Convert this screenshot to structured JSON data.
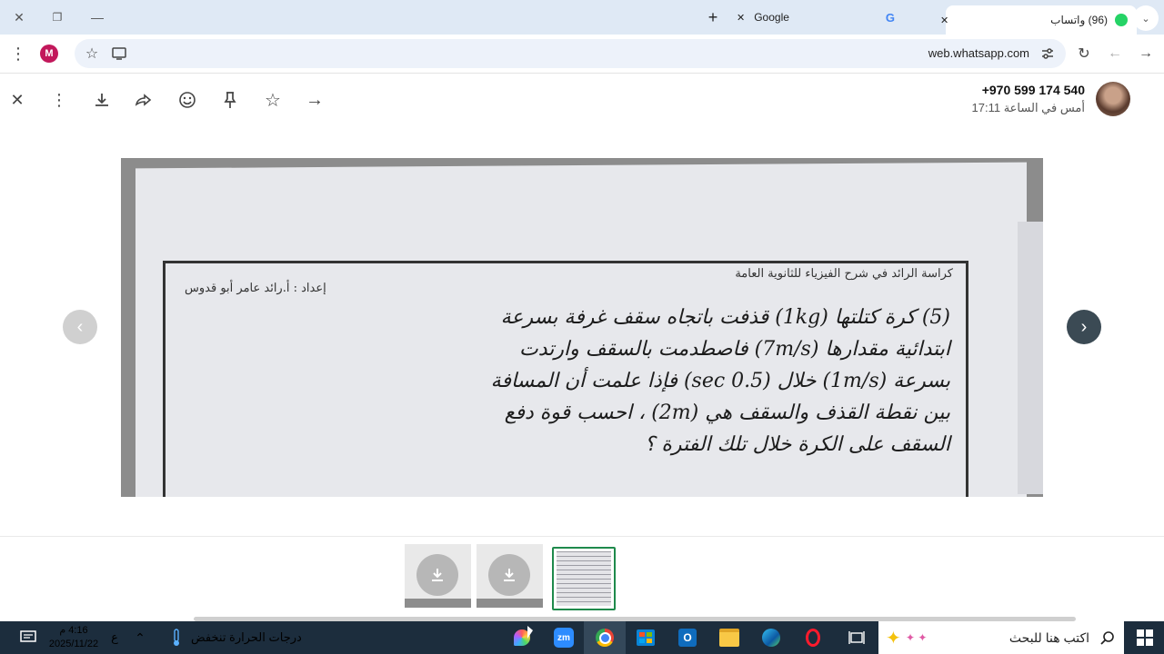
{
  "browser": {
    "tabs": [
      {
        "label": "(96) واتساب",
        "active": true
      },
      {
        "label": "Google",
        "active": false
      }
    ],
    "url": "web.whatsapp.com",
    "profile_initial": "M",
    "new_tab_label": "+",
    "tab_close": "✕"
  },
  "viewer": {
    "sender": "+970 599 174 540",
    "timestamp": "أمس في الساعة 17:11"
  },
  "document": {
    "header_right": "كراسة الرائد في شرح الفيزياء للثانوية العامة",
    "header_left": "إعداد : أ.رائد عامر أبو قدوس",
    "question_lines": [
      "(5) كرة كتلتها (1kg) قذفت باتجاه سقف غرفة بسرعة",
      "ابتدائية مقدارها (7m/s) فاصطدمت بالسقف وارتدت",
      "بسرعة (1m/s) خلال (0.5 sec) فإذا علمت أن المسافة",
      "بين نقطة القذف والسقف هي (2m) ، احسب قوة دفع",
      "السقف على الكرة خلال تلك الفترة ؟"
    ]
  },
  "taskbar": {
    "search_placeholder": "اكتب هنا للبحث",
    "weather_text": "درجات الحرارة تنخفض",
    "time": "4:16 م",
    "date": "2025/11/22",
    "lang": "ع",
    "zoom_label": "zm"
  },
  "colors": {
    "tabbar_bg": "#dfe9f5",
    "taskbar_bg": "#1c2d3d",
    "avatar_m": "#c2185b",
    "whatsapp_green": "#25d366",
    "thumb_selected_border": "#1f8a4c"
  }
}
